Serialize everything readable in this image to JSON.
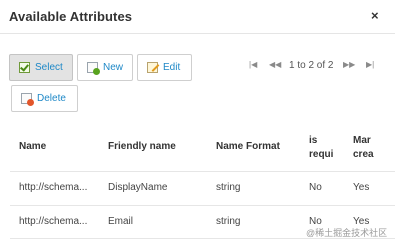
{
  "dialog": {
    "title": "Available Attributes",
    "close_glyph": "×"
  },
  "toolbar": {
    "select_label": "Select",
    "new_label": "New",
    "edit_label": "Edit",
    "delete_label": "Delete"
  },
  "pager": {
    "text": "1 to 2 of 2",
    "first_glyph": "|◀",
    "prev_glyph": "◀◀",
    "next_glyph": "▶▶",
    "last_glyph": "▶|"
  },
  "table": {
    "columns": [
      "Name",
      "Friendly name",
      "Name Format",
      "is",
      "requi",
      "Mar",
      "crea"
    ],
    "rows": [
      {
        "name": "http://schema...",
        "friendly": "DisplayName",
        "format": "string",
        "required": "No",
        "mandatory": "Yes"
      },
      {
        "name": "http://schema...",
        "friendly": "Email",
        "format": "string",
        "required": "No",
        "mandatory": "Yes"
      }
    ]
  },
  "watermark": "@稀土掘金技术社区",
  "colors": {
    "accent_text": "#1e88c7",
    "active_button_bg": "#e3e3e3"
  }
}
